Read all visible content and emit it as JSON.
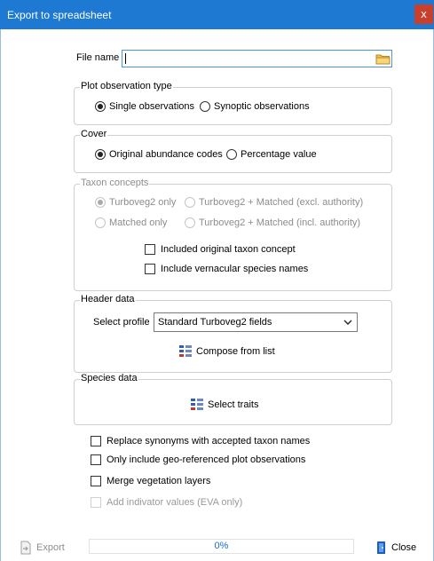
{
  "window": {
    "title": "Export to spreadsheet",
    "close_glyph": "x"
  },
  "file_name": {
    "label": "File name",
    "value": "",
    "browse_icon": "folder-icon"
  },
  "plot_observation_type": {
    "title": "Plot observation type",
    "options": [
      "Single observations",
      "Synoptic observations"
    ],
    "selected": "Single observations"
  },
  "cover": {
    "title": "Cover",
    "options": [
      "Original abundance codes",
      "Percentage value"
    ],
    "selected": "Original abundance codes"
  },
  "taxon_concepts": {
    "title": "Taxon concepts",
    "enabled": false,
    "options": [
      "Turboveg2 only",
      "Turboveg2 + Matched (excl. authority)",
      "Matched only",
      "Turboveg2 + Matched (incl. authority)"
    ],
    "selected": "Turboveg2 only",
    "checks": [
      {
        "label": "Included original taxon concept",
        "checked": false
      },
      {
        "label": "Include vernacular species names",
        "checked": false
      }
    ]
  },
  "header_data": {
    "title": "Header data",
    "select_label": "Select profile",
    "profile_value": "Standard Turboveg2 fields",
    "compose_label": "Compose from list",
    "compose_icon": "list-icon"
  },
  "species_data": {
    "title": "Species data",
    "select_traits_label": "Select traits",
    "select_traits_icon": "list-icon"
  },
  "options": [
    {
      "label": "Replace synonyms with accepted taxon names",
      "checked": false,
      "enabled": true
    },
    {
      "label": "Only include geo-referenced plot observations",
      "checked": false,
      "enabled": true
    },
    {
      "label": "Merge vegetation layers",
      "checked": false,
      "enabled": true
    },
    {
      "label": "Add indivator values (EVA only)",
      "checked": false,
      "enabled": false
    }
  ],
  "footer": {
    "export_label": "Export",
    "export_enabled": false,
    "progress_text": "0%",
    "progress_value": 0,
    "close_label": "Close"
  },
  "colors": {
    "titlebar": "#1d79d2",
    "close_button": "#c8402b",
    "progress_text": "#1b6cd4"
  }
}
